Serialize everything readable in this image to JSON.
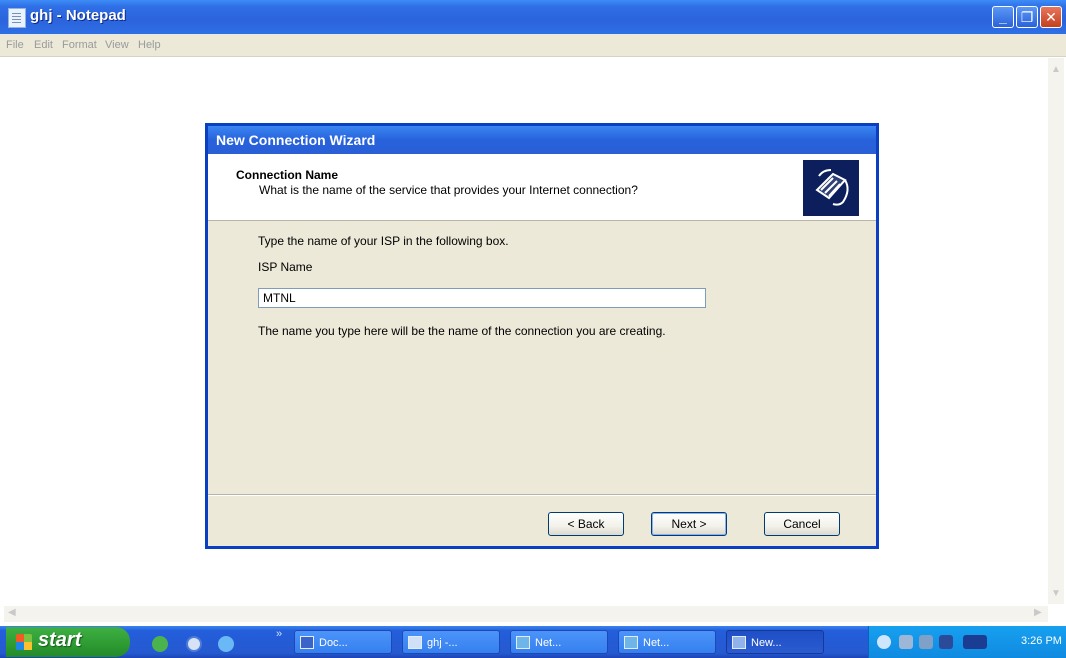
{
  "notepad": {
    "title": "ghj - Notepad",
    "menu": [
      "File",
      "Edit",
      "Format",
      "View",
      "Help"
    ]
  },
  "wizard": {
    "title": "New Connection Wizard",
    "header_title": "Connection Name",
    "header_subtitle": "What is the name of the service that provides your Internet connection?",
    "instruction": "Type the name of your ISP in the following box.",
    "isp_label": "ISP Name",
    "isp_value": "MTNL",
    "note": "The name you type here will be the name of the connection you are creating.",
    "buttons": {
      "back": "< Back",
      "next": "Next >",
      "cancel": "Cancel"
    },
    "header_icon": "phone-handset-icon"
  },
  "taskbar": {
    "start_label": "start",
    "tasks": [
      "Doc...",
      "ghj -...",
      "Net...",
      "Net...",
      "New..."
    ],
    "clock": "3:26 PM"
  },
  "colors": {
    "titlebar_blue": "#2b63db",
    "taskbar_blue": "#245edb",
    "start_green": "#2d9a32",
    "dialog_face": "#ece9d8"
  }
}
